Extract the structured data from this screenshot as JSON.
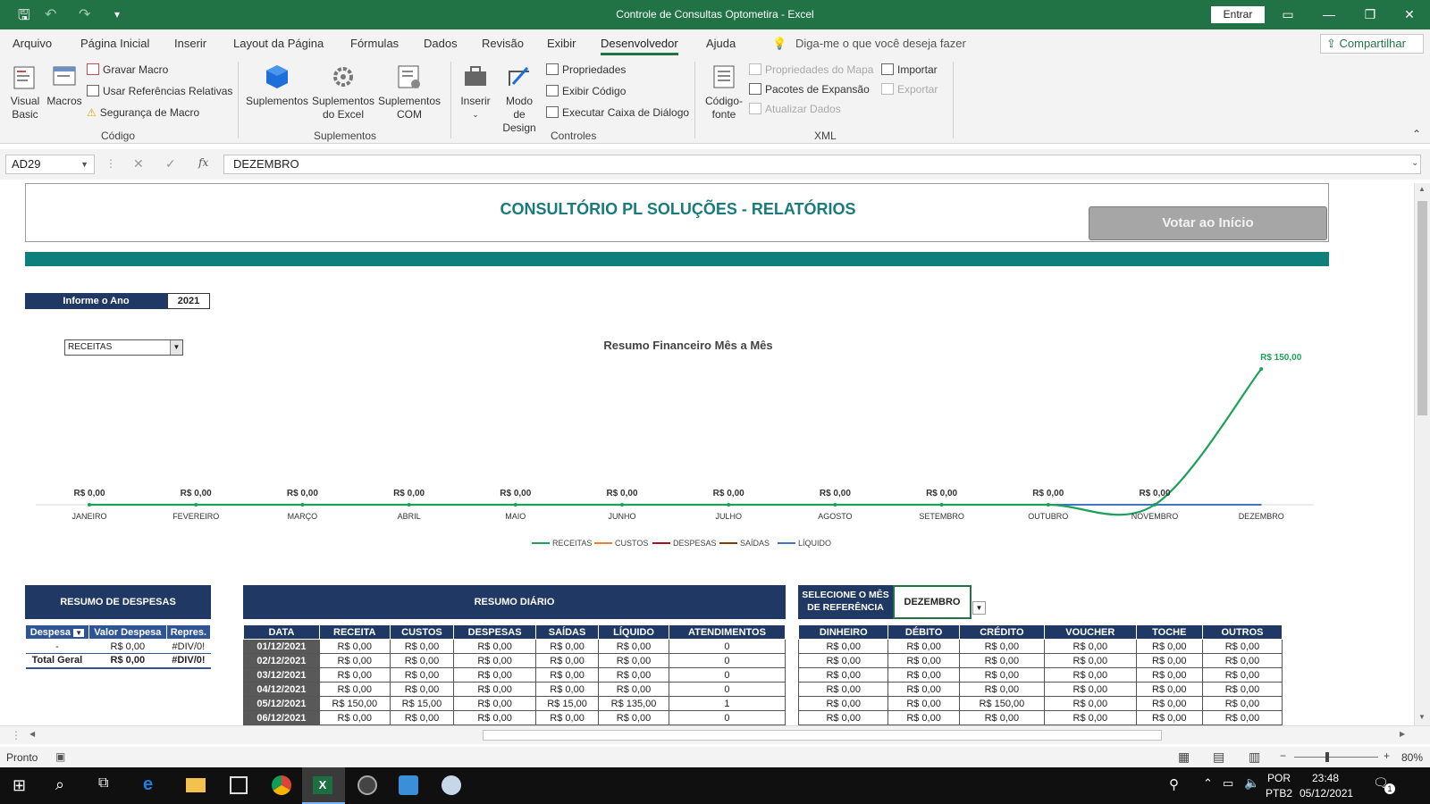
{
  "app": {
    "title": "Controle de Consultas Optometira  -  Excel",
    "signin": "Entrar",
    "share": "Compartilhar"
  },
  "menu": {
    "tabs": [
      "Arquivo",
      "Página Inicial",
      "Inserir",
      "Layout da Página",
      "Fórmulas",
      "Dados",
      "Revisão",
      "Exibir",
      "Desenvolvedor",
      "Ajuda"
    ],
    "tell_me": "Diga-me o que você deseja fazer"
  },
  "ribbon": {
    "codigo": {
      "visual_basic": "Visual Basic",
      "macros": "Macros",
      "gravar": "Gravar Macro",
      "usar_ref": "Usar Referências Relativas",
      "seguranca": "Segurança de Macro",
      "group": "Código"
    },
    "suplementos": {
      "suplementos": "Suplementos",
      "excel": "Suplementos do Excel",
      "com": "Suplementos COM",
      "group": "Suplementos"
    },
    "controles": {
      "inserir": "Inserir",
      "modo": "Modo de Design",
      "propriedades": "Propriedades",
      "exibir_codigo": "Exibir Código",
      "executar": "Executar Caixa de Diálogo",
      "group": "Controles"
    },
    "xml": {
      "codigo_fonte": "Código-fonte",
      "prop_mapa": "Propriedades do Mapa",
      "pacotes": "Pacotes de Expansão",
      "atualizar": "Atualizar Dados",
      "importar": "Importar",
      "exportar": "Exportar",
      "group": "XML"
    }
  },
  "formula_bar": {
    "name_box": "AD29",
    "fx": "fx",
    "value": "DEZEMBRO"
  },
  "sheet": {
    "report_title": "CONSULTÓRIO PL SOLUÇÕES - RELATÓRIOS",
    "back_button": "Votar ao Início",
    "year_label": "Informe o Ano",
    "year_value": "2021",
    "chart_selector": "RECEITAS"
  },
  "chart_data": {
    "type": "line",
    "title": "Resumo Financeiro Mês a Mês",
    "categories": [
      "JANEIRO",
      "FEVEREIRO",
      "MARÇO",
      "ABRIL",
      "MAIO",
      "JUNHO",
      "JULHO",
      "AGOSTO",
      "SETEMBRO",
      "OUTUBRO",
      "NOVEMBRO",
      "DEZEMBRO"
    ],
    "data_labels": [
      "R$ 0,00",
      "R$ 0,00",
      "R$ 0,00",
      "R$ 0,00",
      "R$ 0,00",
      "R$ 0,00",
      "R$ 0,00",
      "R$ 0,00",
      "R$ 0,00",
      "R$ 0,00",
      "R$ 0,00",
      "R$ 150,00"
    ],
    "series": [
      {
        "name": "RECEITAS",
        "color": "#1ba15a",
        "values": [
          0,
          0,
          0,
          0,
          0,
          0,
          0,
          0,
          0,
          0,
          0,
          150
        ]
      },
      {
        "name": "CUSTOS",
        "color": "#ed7d31",
        "values": [
          0,
          0,
          0,
          0,
          0,
          0,
          0,
          0,
          0,
          0,
          0,
          0
        ]
      },
      {
        "name": "DESPESAS",
        "color": "#a5151b",
        "values": [
          0,
          0,
          0,
          0,
          0,
          0,
          0,
          0,
          0,
          0,
          0,
          0
        ]
      },
      {
        "name": "SAÍDAS",
        "color": "#843c0c",
        "values": [
          0,
          0,
          0,
          0,
          0,
          0,
          0,
          0,
          0,
          0,
          0,
          0
        ]
      },
      {
        "name": "LÍQUIDO",
        "color": "#4472c4",
        "values": [
          0,
          0,
          0,
          0,
          0,
          0,
          0,
          0,
          0,
          0,
          0,
          0
        ]
      }
    ],
    "ylim": [
      0,
      150
    ],
    "legend_position": "bottom",
    "grid": false
  },
  "despesas": {
    "title": "RESUMO DE DESPESAS",
    "headers": [
      "Despesa",
      "Valor Despesa",
      "Repres."
    ],
    "rows": [
      [
        "-",
        "R$ 0,00",
        "#DIV/0!"
      ],
      [
        "Total Geral",
        "R$ 0,00",
        "#DIV/0!"
      ]
    ]
  },
  "diario": {
    "title": "RESUMO DIÁRIO",
    "headers": [
      "DATA",
      "RECEITA",
      "CUSTOS",
      "DESPESAS",
      "SAÍDAS",
      "LÍQUIDO",
      "ATENDIMENTOS"
    ],
    "rows": [
      [
        "01/12/2021",
        "R$ 0,00",
        "R$ 0,00",
        "R$ 0,00",
        "R$ 0,00",
        "R$ 0,00",
        "0"
      ],
      [
        "02/12/2021",
        "R$ 0,00",
        "R$ 0,00",
        "R$ 0,00",
        "R$ 0,00",
        "R$ 0,00",
        "0"
      ],
      [
        "03/12/2021",
        "R$ 0,00",
        "R$ 0,00",
        "R$ 0,00",
        "R$ 0,00",
        "R$ 0,00",
        "0"
      ],
      [
        "04/12/2021",
        "R$ 0,00",
        "R$ 0,00",
        "R$ 0,00",
        "R$ 0,00",
        "R$ 0,00",
        "0"
      ],
      [
        "05/12/2021",
        "R$ 150,00",
        "R$ 15,00",
        "R$ 0,00",
        "R$ 15,00",
        "R$ 135,00",
        "1"
      ],
      [
        "06/12/2021",
        "R$ 0,00",
        "R$ 0,00",
        "R$ 0,00",
        "R$ 0,00",
        "R$ 0,00",
        "0"
      ]
    ]
  },
  "pagamentos": {
    "select_label": "SELECIONE O MÊS DE REFERÊNCIA",
    "month": "DEZEMBRO",
    "headers": [
      "DINHEIRO",
      "DÉBITO",
      "CRÉDITO",
      "VOUCHER",
      "TOCHE",
      "OUTROS"
    ],
    "rows": [
      [
        "R$ 0,00",
        "R$ 0,00",
        "R$ 0,00",
        "R$ 0,00",
        "R$ 0,00",
        "R$ 0,00"
      ],
      [
        "R$ 0,00",
        "R$ 0,00",
        "R$ 0,00",
        "R$ 0,00",
        "R$ 0,00",
        "R$ 0,00"
      ],
      [
        "R$ 0,00",
        "R$ 0,00",
        "R$ 0,00",
        "R$ 0,00",
        "R$ 0,00",
        "R$ 0,00"
      ],
      [
        "R$ 0,00",
        "R$ 0,00",
        "R$ 0,00",
        "R$ 0,00",
        "R$ 0,00",
        "R$ 0,00"
      ],
      [
        "R$ 0,00",
        "R$ 0,00",
        "R$ 150,00",
        "R$ 0,00",
        "R$ 0,00",
        "R$ 0,00"
      ],
      [
        "R$ 0,00",
        "R$ 0,00",
        "R$ 0,00",
        "R$ 0,00",
        "R$ 0,00",
        "R$ 0,00"
      ]
    ]
  },
  "status": {
    "ready": "Pronto",
    "zoom": "80%"
  },
  "taskbar": {
    "lang1": "POR",
    "lang2": "PTB2",
    "time": "23:48",
    "date": "05/12/2021",
    "notifications": "1"
  }
}
